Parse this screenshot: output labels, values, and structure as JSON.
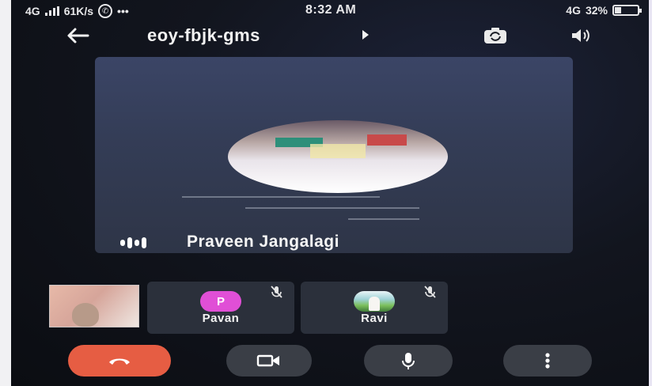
{
  "status_bar": {
    "network_left": "4G",
    "speed": "61K/s",
    "notification_dots": "•••",
    "time": "8:32 AM",
    "network_right": "4G",
    "battery": "32%",
    "icons": [
      "signal-icon",
      "whatsapp-icon",
      "battery-icon"
    ]
  },
  "header": {
    "meeting_code": "eoy-fbjk-gms",
    "icons": [
      "back-arrow-icon",
      "caret-right-icon",
      "switch-camera-icon",
      "speaker-icon"
    ]
  },
  "main_tile": {
    "speaker_name": "Praveen Jangalagi",
    "icon": "speaking-indicator-icon"
  },
  "participants": [
    {
      "name": "Pavan",
      "initial": "P",
      "avatar_color": "#e04fd6",
      "muted": true
    },
    {
      "name": "Ravi",
      "initial": "",
      "muted": true
    }
  ],
  "controls": {
    "end_call_color": "#e65d43",
    "icons": [
      "end-call-icon",
      "video-camera-icon",
      "microphone-icon",
      "more-options-icon"
    ]
  }
}
